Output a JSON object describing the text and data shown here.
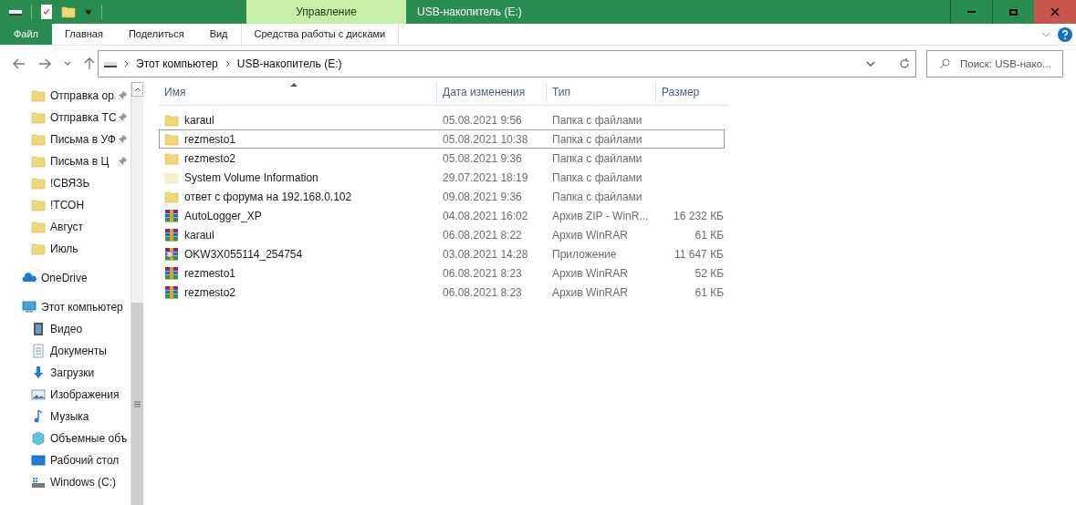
{
  "window": {
    "title": "USB-накопитель (E:)",
    "context_tab": "Управление"
  },
  "ribbon": {
    "tabs": [
      {
        "label": "Файл",
        "kind": "file",
        "selected": false
      },
      {
        "label": "Главная",
        "kind": "tab",
        "selected": false
      },
      {
        "label": "Поделиться",
        "kind": "tab",
        "selected": false
      },
      {
        "label": "Вид",
        "kind": "tab",
        "selected": false
      },
      {
        "label": "Средства работы с дисками",
        "kind": "context",
        "selected": false
      }
    ]
  },
  "address": {
    "path": [
      "Этот компьютер",
      "USB-накопитель (E:)"
    ]
  },
  "search": {
    "placeholder": "Поиск: USB-нако..."
  },
  "sidebar": {
    "items": [
      {
        "label": "Отправка ор",
        "kind": "folder",
        "pinned": true
      },
      {
        "label": "Отправка ТС",
        "kind": "folder",
        "pinned": true
      },
      {
        "label": "Письма в УФ",
        "kind": "folder",
        "pinned": true
      },
      {
        "label": "Письма в Ц",
        "kind": "folder",
        "pinned": true
      },
      {
        "label": "!СВЯЗЬ",
        "kind": "folder",
        "pinned": false
      },
      {
        "label": "!ТСОН",
        "kind": "folder",
        "pinned": false
      },
      {
        "label": "Август",
        "kind": "folder",
        "pinned": false
      },
      {
        "label": "Июль",
        "kind": "folder",
        "pinned": false
      },
      {
        "label": "OneDrive",
        "kind": "cloud",
        "pinned": false
      },
      {
        "label": "Этот компьютер",
        "kind": "computer",
        "pinned": false
      },
      {
        "label": "Видео",
        "kind": "video",
        "pinned": false
      },
      {
        "label": "Документы",
        "kind": "documents",
        "pinned": false
      },
      {
        "label": "Загрузки",
        "kind": "downloads",
        "pinned": false
      },
      {
        "label": "Изображения",
        "kind": "images",
        "pinned": false
      },
      {
        "label": "Музыка",
        "kind": "music",
        "pinned": false
      },
      {
        "label": "Объемные объ",
        "kind": "objects",
        "pinned": false
      },
      {
        "label": "Рабочий стол",
        "kind": "desktop",
        "pinned": false
      },
      {
        "label": "Windows (C:)",
        "kind": "system-drive",
        "pinned": false
      }
    ]
  },
  "table": {
    "columns": [
      "Имя",
      "Дата изменения",
      "Тип",
      "Размер"
    ],
    "rows": [
      {
        "kind": "folder",
        "name": "karaul",
        "date": "05.08.2021 9:56",
        "type": "Папка с файлами",
        "selected": false
      },
      {
        "kind": "folder",
        "name": "rezmesto1",
        "date": "05.08.2021 10:38",
        "type": "Папка с файлами",
        "selected": true
      },
      {
        "kind": "folder",
        "name": "rezmesto2",
        "date": "05.08.2021 9:36",
        "type": "Папка с файлами",
        "selected": false
      },
      {
        "kind": "hidden-folder",
        "name": "System Volume Information",
        "date": "29.07.2021 18:19",
        "type": "Папка с файлами",
        "selected": false
      },
      {
        "kind": "folder",
        "name": "ответ с форума на 192.168.0.102",
        "date": "09.08.2021 9:36",
        "type": "Папка с файлами",
        "selected": false
      },
      {
        "kind": "archive",
        "name": "AutoLogger_XP",
        "date": "04.08.2021 16:02",
        "type": "Архив ZIP - WinR...",
        "size": "16 232 КБ",
        "selected": false
      },
      {
        "kind": "archive",
        "name": "karaul",
        "date": "06.08.2021 8:22",
        "type": "Архив WinRAR",
        "size": "61 КБ",
        "selected": false
      },
      {
        "kind": "exe",
        "name": "OKW3X055114_254754",
        "date": "03.08.2021 14:28",
        "type": "Приложение",
        "size": "11 647 КБ",
        "selected": false
      },
      {
        "kind": "archive",
        "name": "rezmesto1",
        "date": "06.08.2021 8:23",
        "type": "Архив WinRAR",
        "size": "52 КБ",
        "selected": false
      },
      {
        "kind": "archive",
        "name": "rezmesto2",
        "date": "06.08.2021 8:23",
        "type": "Архив WinRAR",
        "size": "61 КБ",
        "selected": false
      }
    ]
  }
}
